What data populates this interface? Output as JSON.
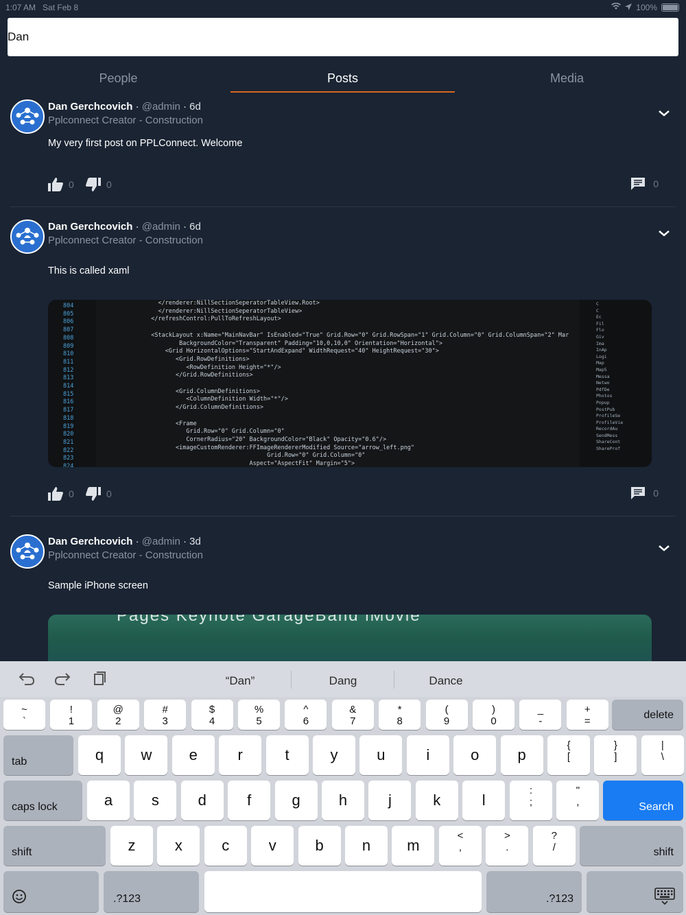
{
  "status_bar": {
    "time": "1:07 AM",
    "date": "Sat Feb 8",
    "battery": "100%"
  },
  "search": {
    "value": "Dan",
    "placeholder": ""
  },
  "tabs": [
    {
      "label": "People",
      "active": false
    },
    {
      "label": "Posts",
      "active": true
    },
    {
      "label": "Media",
      "active": false
    }
  ],
  "posts": [
    {
      "author": "Dan Gerchcovich",
      "handle": "@admin",
      "separator": "·",
      "time": "6d",
      "subtitle": "Pplconnect Creator - Construction",
      "body": "My very first post on PPLConnect. Welcome",
      "likes": "0",
      "dislikes": "0",
      "comments": "0"
    },
    {
      "author": "Dan Gerchcovich",
      "handle": "@admin",
      "separator": "·",
      "time": "6d",
      "subtitle": "Pplconnect Creator - Construction",
      "body": "This is called xaml",
      "likes": "0",
      "dislikes": "0",
      "comments": "0"
    },
    {
      "author": "Dan Gerchcovich",
      "handle": "@admin",
      "separator": "·",
      "time": "3d",
      "subtitle": "Pplconnect Creator - Construction",
      "body": "Sample iPhone screen"
    }
  ],
  "code_image": {
    "line_numbers": [
      "804",
      "805",
      "806",
      "807",
      "808",
      "809",
      "810",
      "811",
      "812",
      "813",
      "814",
      "815",
      "816",
      "817",
      "818",
      "819",
      "820",
      "821",
      "822",
      "823",
      "824"
    ],
    "lines": [
      "    </renderer:NillSectionSeperatorTableView.Root>",
      "    </renderer:NillSectionSeperatorTableView>",
      "  </refreshControl:PullToRefreshLayout>",
      "",
      "  <StackLayout x:Name=\"MainNavBar\" IsEnabled=\"True\" Grid.Row=\"0\" Grid.RowSpan=\"1\" Grid.Column=\"0\" Grid.ColumnSpan=\"2\" Mar",
      "          BackgroundColor=\"Transparent\" Padding=\"10,0,10,0\" Orientation=\"Horizontal\">",
      "      <Grid HorizontalOptions=\"StartAndExpand\" WidthRequest=\"40\" HeightRequest=\"30\">",
      "         <Grid.RowDefinitions>",
      "            <RowDefinition Height=\"*\"/>",
      "         </Grid.RowDefinitions>",
      "",
      "         <Grid.ColumnDefinitions>",
      "            <ColumnDefinition Width=\"*\"/>",
      "         </Grid.ColumnDefinitions>",
      "",
      "         <Frame",
      "            Grid.Row=\"0\" Grid.Column=\"0\"",
      "            CornerRadius=\"20\" BackgroundColor=\"Black\" Opacity=\"0.6\"/>",
      "         <imageCustomRenderer:FFImageRendererModified Source=\"arrow_left.png\"",
      "                                   Grid.Row=\"0\" Grid.Column=\"0\"",
      "                              Aspect=\"AspectFit\" Margin=\"5\">"
    ],
    "sidebar": [
      "C",
      "C",
      "Ec",
      "Fil",
      "Flo",
      "Giv",
      "Ima",
      "InAp",
      "Logi",
      "Map",
      "Map5",
      "Messa",
      "Netwo",
      "PdfDe",
      "Photos",
      "Popup",
      "PostPub",
      "ProfileSe",
      "ProfileVie",
      "RecordAu",
      "SendMess",
      "ShareCont",
      "ShareProf"
    ]
  },
  "phone_image": {
    "app_labels": "Pages      Keynote      GarageBand      iMovie"
  },
  "keyboard": {
    "suggestions": [
      "“Dan”",
      "Dang",
      "Dance"
    ],
    "row1": [
      {
        "top": "~",
        "bot": "`"
      },
      {
        "top": "!",
        "bot": "1"
      },
      {
        "top": "@",
        "bot": "2"
      },
      {
        "top": "#",
        "bot": "3"
      },
      {
        "top": "$",
        "bot": "4"
      },
      {
        "top": "%",
        "bot": "5"
      },
      {
        "top": "^",
        "bot": "6"
      },
      {
        "top": "&",
        "bot": "7"
      },
      {
        "top": "*",
        "bot": "8"
      },
      {
        "top": "(",
        "bot": "9"
      },
      {
        "top": ")",
        "bot": "0"
      },
      {
        "top": "_",
        "bot": "-"
      },
      {
        "top": "+",
        "bot": "="
      }
    ],
    "delete": "delete",
    "tab": "tab",
    "row2": [
      "q",
      "w",
      "e",
      "r",
      "t",
      "y",
      "u",
      "i",
      "o",
      "p"
    ],
    "row2_sym": [
      {
        "top": "{",
        "bot": "["
      },
      {
        "top": "}",
        "bot": "]"
      },
      {
        "top": "|",
        "bot": "\\"
      }
    ],
    "caps": "caps lock",
    "row3": [
      "a",
      "s",
      "d",
      "f",
      "g",
      "h",
      "j",
      "k",
      "l"
    ],
    "row3_sym": [
      {
        "top": ":",
        "bot": ";"
      },
      {
        "top": "\"",
        "bot": ","
      }
    ],
    "search": "Search",
    "shift": "shift",
    "row4": [
      "z",
      "x",
      "c",
      "v",
      "b",
      "n",
      "m"
    ],
    "row4_sym": [
      {
        "top": "<",
        "bot": ","
      },
      {
        "top": ">",
        "bot": "."
      },
      {
        "top": "?",
        "bot": "/"
      }
    ],
    "numbers": ".?123"
  },
  "colors": {
    "background": "#1a2433",
    "accent": "#d9661f",
    "search_key": "#1a7cf2"
  }
}
